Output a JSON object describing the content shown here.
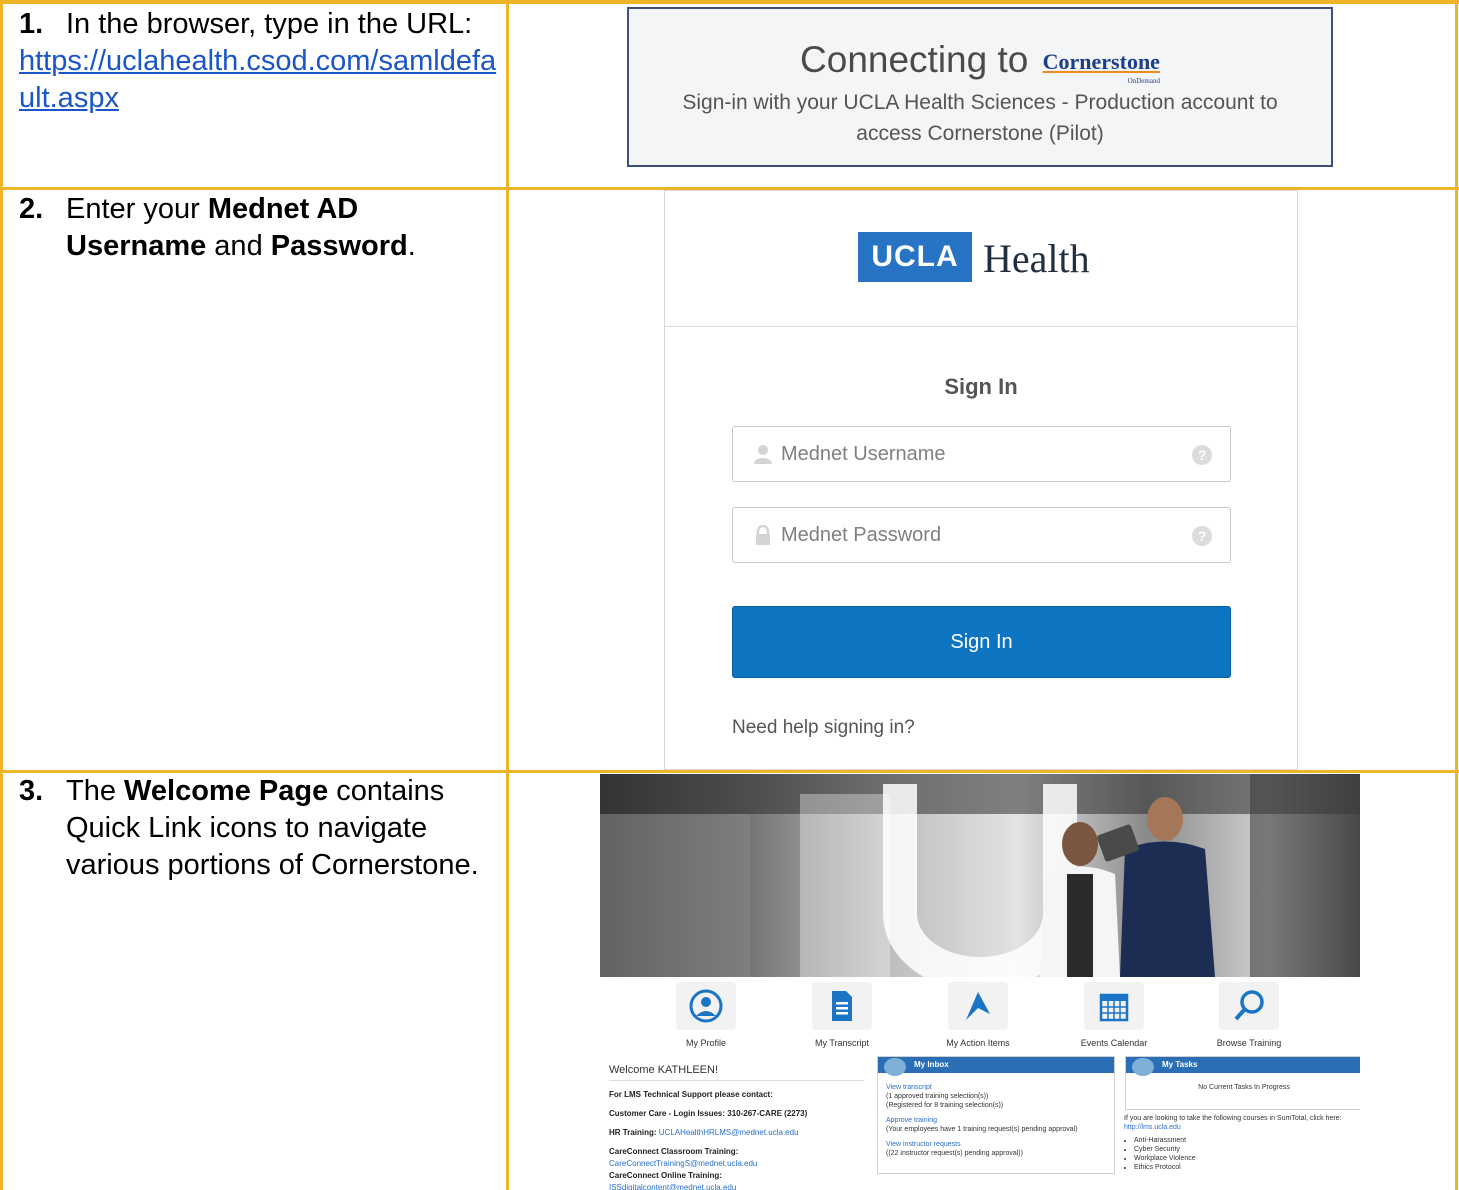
{
  "steps": [
    {
      "number": "1.",
      "text_before": "In the browser, type in the URL:",
      "url": "https://uclahealth.csod.com/samldefault.aspx"
    },
    {
      "number": "2.",
      "text_1": "Enter your ",
      "bold_1": "Mednet AD Username",
      "text_2": " and ",
      "bold_2": "Password",
      "text_3": "."
    },
    {
      "number": "3.",
      "text_1": "The ",
      "bold_1": "Welcome Page",
      "text_2": " contains Quick Link icons to navigate various portions of Cornerstone."
    }
  ],
  "connect_screen": {
    "title": "Connecting to",
    "logo_text": "Cornerstone",
    "logo_sub": "OnDemand",
    "subtitle": "Sign-in with your UCLA Health Sciences - Production account to access Cornerstone (Pilot)"
  },
  "login_screen": {
    "logo_box": "UCLA",
    "logo_word": "Health",
    "heading": "Sign In",
    "username_placeholder": "Mednet Username",
    "password_placeholder": "Mednet Password",
    "button_label": "Sign In",
    "help_link": "Need help signing in?",
    "help_glyph": "?"
  },
  "welcome_screen": {
    "quick_links": [
      {
        "label": "My Profile",
        "icon": "profile-icon"
      },
      {
        "label": "My Transcript",
        "icon": "transcript-icon"
      },
      {
        "label": "My Action Items",
        "icon": "action-items-icon"
      },
      {
        "label": "Events Calendar",
        "icon": "calendar-icon"
      },
      {
        "label": "Browse Training",
        "icon": "search-icon"
      }
    ],
    "greeting": "Welcome KATHLEEN!",
    "support_heading": "For LMS Technical Support please contact:",
    "customer_care": "Customer Care - Login Issues: 310-267-CARE (2273)",
    "hr_label": "HR Training: ",
    "hr_email": "UCLAHealthHRLMS@mednet.ucla.edu",
    "cc_classroom_label": "CareConnect Classroom Training:",
    "cc_classroom_email": "CareConnectTrainingS@mednet.ucla.edu",
    "cc_online_label": "CareConnect Online Training:",
    "cc_online_email": "ISSdigitalcontent@mednet.ucla.edu",
    "inbox": {
      "title": "My Inbox",
      "link_1": "View transcript",
      "line_1a": "(1 approved training selection(s))",
      "line_1b": "(Registered for 8 training selection(s))",
      "link_2": "Approve training",
      "line_2": "(Your employees have 1 training request(s) pending approval)",
      "link_3": "View instructor requests",
      "line_3": "((22 instructor request(s) pending approval))"
    },
    "tasks": {
      "title": "My Tasks",
      "empty": "No Current Tasks In Progress",
      "note": "If you are looking to take the following courses in SumTotal, click here: ",
      "note_link": "http://lms.ucla.edu",
      "courses": [
        "Anti-Harassment",
        "Cyber Security",
        "Workplace Violence",
        "Ethics Protocol"
      ]
    }
  }
}
